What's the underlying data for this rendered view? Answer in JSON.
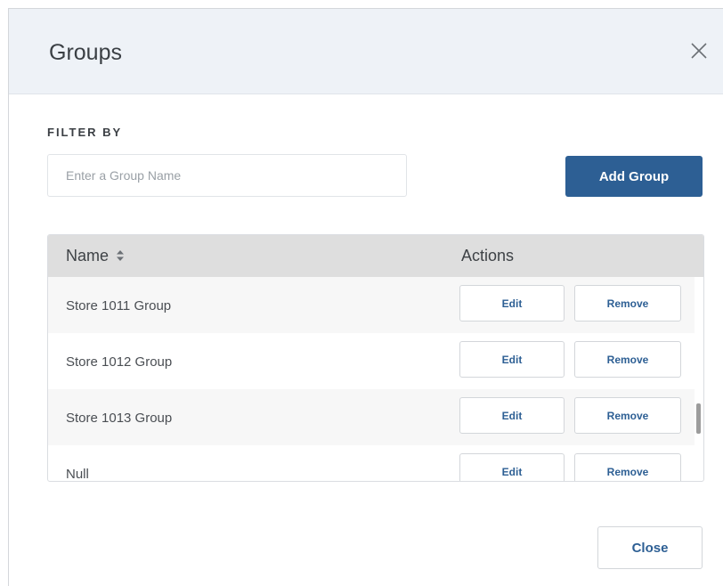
{
  "dialog": {
    "title": "Groups",
    "close_icon": "close-icon"
  },
  "filter": {
    "label": "FILTER BY",
    "placeholder": "Enter a Group Name",
    "value": ""
  },
  "toolbar": {
    "add_group_label": "Add Group"
  },
  "table": {
    "columns": [
      "Name",
      "Actions"
    ],
    "sort_icon": "sort-icon",
    "rows": [
      {
        "name": "Store 1011 Group",
        "edit": "Edit",
        "remove": "Remove"
      },
      {
        "name": "Store 1012 Group",
        "edit": "Edit",
        "remove": "Remove"
      },
      {
        "name": "Store 1013 Group",
        "edit": "Edit",
        "remove": "Remove"
      },
      {
        "name": "Null",
        "edit": "Edit",
        "remove": "Remove"
      }
    ]
  },
  "footer": {
    "close_label": "Close"
  },
  "colors": {
    "primary": "#2d5f94",
    "header_bg": "#eef2f7",
    "table_head_bg": "#dedede"
  }
}
